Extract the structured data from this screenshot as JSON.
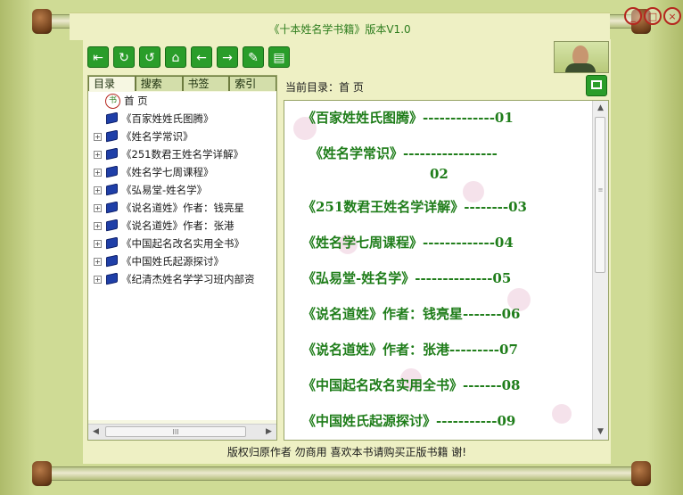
{
  "window": {
    "title": "《十本姓名学书籍》版本V1.0",
    "controls": {
      "minimize": "_",
      "maximize": "□",
      "close": "×"
    }
  },
  "toolbar": {
    "buttons": [
      {
        "icon": "exit-icon",
        "glyph": "⇤"
      },
      {
        "icon": "refresh-icon",
        "glyph": "↻"
      },
      {
        "icon": "reload-icon",
        "glyph": "↺"
      },
      {
        "icon": "home-icon",
        "glyph": "⌂"
      },
      {
        "icon": "back-icon",
        "glyph": "←"
      },
      {
        "icon": "forward-icon",
        "glyph": "→"
      },
      {
        "icon": "search-icon",
        "glyph": "✎"
      },
      {
        "icon": "notes-icon",
        "glyph": "▤"
      }
    ]
  },
  "sidebar": {
    "tabs": [
      "目录",
      "搜索",
      "书签",
      "索引"
    ],
    "active_tab": "目录",
    "tree": [
      {
        "label": "首 页",
        "type": "home",
        "expandable": false
      },
      {
        "label": "《百家姓姓氏图腾》",
        "type": "book",
        "expandable": false
      },
      {
        "label": "《姓名学常识》",
        "type": "book",
        "expandable": true
      },
      {
        "label": "《251数君王姓名学详解》",
        "type": "book",
        "expandable": true
      },
      {
        "label": "《姓名学七周课程》",
        "type": "book",
        "expandable": true
      },
      {
        "label": "《弘易堂-姓名学》",
        "type": "book",
        "expandable": true
      },
      {
        "label": "《说名道姓》作者：钱亮星",
        "type": "book",
        "expandable": true
      },
      {
        "label": "《说名道姓》作者：张港",
        "type": "book",
        "expandable": true
      },
      {
        "label": "《中国起名改名实用全书》",
        "type": "book",
        "expandable": true
      },
      {
        "label": "《中国姓氏起源探讨》",
        "type": "book",
        "expandable": true
      },
      {
        "label": "《纪清杰姓名学学习班内部资",
        "type": "book",
        "expandable": true
      }
    ],
    "hscroll_grip": "III"
  },
  "content": {
    "current_dir_label": "当前目录：首 页",
    "entries": [
      {
        "line1": "《百家姓姓氏图腾》-------------01",
        "line2": ""
      },
      {
        "line1": "《姓名学常识》-----------------",
        "line2": "02"
      },
      {
        "line1": "《251数君王姓名学详解》--------03",
        "line2": ""
      },
      {
        "line1": "《姓名学七周课程》-------------04",
        "line2": ""
      },
      {
        "line1": "《弘易堂-姓名学》--------------05",
        "line2": ""
      },
      {
        "line1": "《说名道姓》作者：钱亮星-------06",
        "line2": ""
      },
      {
        "line1": "《说名道姓》作者：张港---------07",
        "line2": ""
      },
      {
        "line1": "《中国起名改名实用全书》-------08",
        "line2": ""
      },
      {
        "line1": "《中国姓氏起源探讨》-----------09",
        "line2": ""
      }
    ]
  },
  "status": {
    "text": "版权归原作者 勿商用 喜欢本书请购买正版书籍 谢!"
  },
  "colors": {
    "accent_green": "#2a9d2a",
    "entry_text": "#1f7d1a",
    "frame_olive": "#c9d78c",
    "close_red": "#b5261e"
  }
}
